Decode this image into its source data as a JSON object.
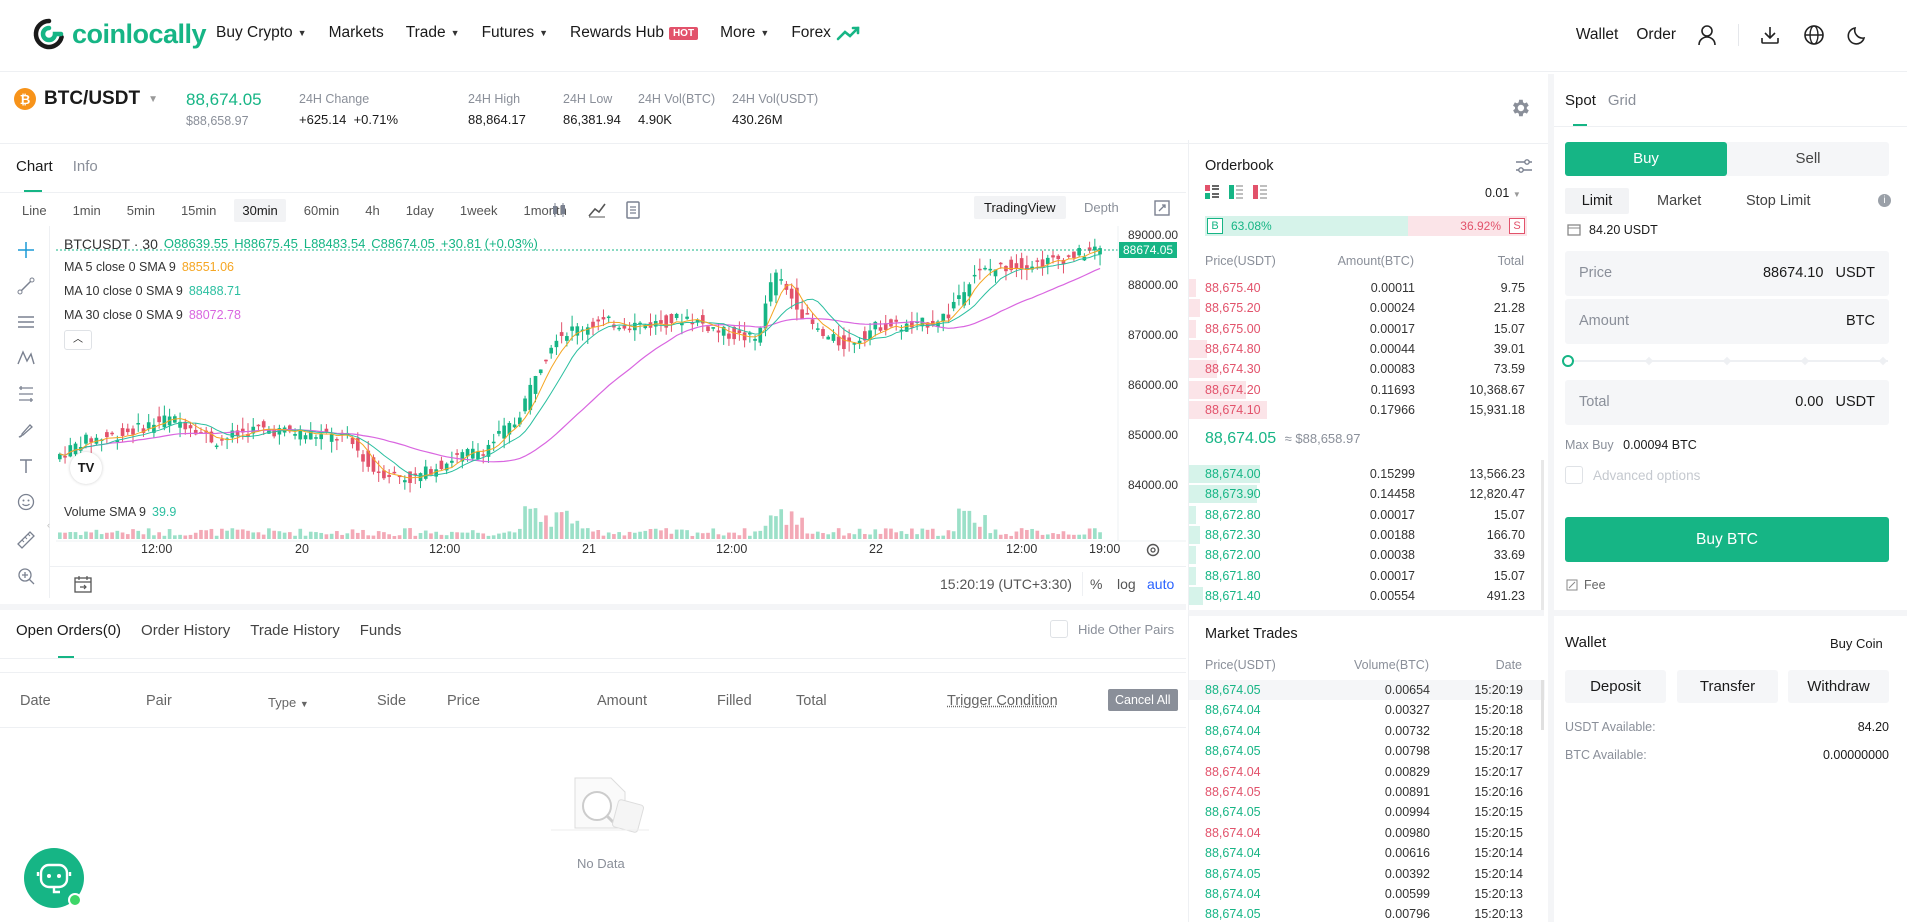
{
  "brand": {
    "name": "coinlocally"
  },
  "nav": {
    "items": [
      {
        "label": "Buy Crypto",
        "caret": true
      },
      {
        "label": "Markets",
        "caret": false
      },
      {
        "label": "Trade",
        "caret": true
      },
      {
        "label": "Futures",
        "caret": true
      },
      {
        "label": "Rewards Hub",
        "caret": false,
        "badge": "HOT"
      },
      {
        "label": "More",
        "caret": true
      },
      {
        "label": "Forex",
        "caret": false
      }
    ],
    "wallet": "Wallet",
    "order": "Order"
  },
  "ticker": {
    "pair": "BTC/USDT",
    "last_price": "88,674.05",
    "last_price_usd": "$88,658.97",
    "change_label": "24H Change",
    "change_abs": "+625.14",
    "change_pct": "+0.71%",
    "high_label": "24H High",
    "high": "88,864.17",
    "low_label": "24H Low",
    "low": "86,381.94",
    "vol_btc_label": "24H Vol(BTC)",
    "vol_btc": "4.90K",
    "vol_usdt_label": "24H Vol(USDT)",
    "vol_usdt": "430.26M"
  },
  "chart_panel": {
    "tabs": [
      "Chart",
      "Info"
    ],
    "timeframes": [
      "Line",
      "1min",
      "5min",
      "15min",
      "30min",
      "60min",
      "4h",
      "1day",
      "1week",
      "1month"
    ],
    "active_timeframe": "30min",
    "view_tradingview": "TradingView",
    "view_depth": "Depth",
    "symbol_line": "BTCUSDT · 30",
    "ohlc": {
      "o": "O88639.55",
      "h": "H88675.45",
      "l": "L88483.54",
      "c": "C88674.05",
      "chg": "+30.81 (+0.03%)"
    },
    "ma5_label": "MA 5 close 0 SMA 9",
    "ma5_value": "88551.06",
    "ma10_label": "MA 10 close 0 SMA 9",
    "ma10_value": "88488.71",
    "ma30_label": "MA 30 close 0 SMA 9",
    "ma30_value": "88072.78",
    "volume_label": "Volume SMA 9",
    "volume_value": "39.9",
    "price_ticks": [
      "89000.00",
      "88000.00",
      "87000.00",
      "86000.00",
      "85000.00",
      "84000.00"
    ],
    "last_tag": "88674.05",
    "time_ticks": [
      "12:00",
      "20",
      "12:00",
      "21",
      "12:00",
      "22",
      "12:00",
      "19:00"
    ],
    "clock": "15:20:19 (UTC+3:30)",
    "scale_pct": "%",
    "scale_log": "log",
    "scale_auto": "auto",
    "colors": {
      "up": "#16b585",
      "down": "#e2526b",
      "ma5": "#f5a623",
      "ma10": "#2bbfa0",
      "ma30": "#d966e0"
    }
  },
  "orders": {
    "tabs": [
      "Open Orders(0)",
      "Order History",
      "Trade History",
      "Funds"
    ],
    "hide_other_pairs": "Hide Other Pairs",
    "columns": [
      "Date",
      "Pair",
      "Type",
      "Side",
      "Price",
      "Amount",
      "Filled",
      "Total",
      "Trigger Condition"
    ],
    "cancel_all": "Cancel All",
    "empty": "No Data"
  },
  "orderbook": {
    "title": "Orderbook",
    "precision": "0.01",
    "buy_ratio_label": "B",
    "buy_ratio": "63.08%",
    "sell_ratio": "36.92%",
    "sell_ratio_label": "S",
    "buy_ratio_fraction": 0.6308,
    "columns": [
      "Price(USDT)",
      "Amount(BTC)",
      "Total"
    ],
    "asks": [
      {
        "price": "88,675.40",
        "amount": "0.00011",
        "total": "9.75",
        "depth": 0.02
      },
      {
        "price": "88,675.20",
        "amount": "0.00024",
        "total": "21.28",
        "depth": 0.03
      },
      {
        "price": "88,675.00",
        "amount": "0.00017",
        "total": "15.07",
        "depth": 0.02
      },
      {
        "price": "88,674.80",
        "amount": "0.00044",
        "total": "39.01",
        "depth": 0.05
      },
      {
        "price": "88,674.30",
        "amount": "0.00083",
        "total": "73.59",
        "depth": 0.08
      },
      {
        "price": "88,674.20",
        "amount": "0.11693",
        "total": "10,368.67",
        "depth": 0.16
      },
      {
        "price": "88,674.10",
        "amount": "0.17966",
        "total": "15,931.18",
        "depth": 0.22
      }
    ],
    "mid_price": "88,674.05",
    "mid_usd": "≈ $88,658.97",
    "bids": [
      {
        "price": "88,674.00",
        "amount": "0.15299",
        "total": "13,566.23",
        "depth": 0.2
      },
      {
        "price": "88,673.90",
        "amount": "0.14458",
        "total": "12,820.47",
        "depth": 0.19
      },
      {
        "price": "88,672.80",
        "amount": "0.00017",
        "total": "15.07",
        "depth": 0.02
      },
      {
        "price": "88,672.30",
        "amount": "0.00188",
        "total": "166.70",
        "depth": 0.03
      },
      {
        "price": "88,672.00",
        "amount": "0.00038",
        "total": "33.69",
        "depth": 0.02
      },
      {
        "price": "88,671.80",
        "amount": "0.00017",
        "total": "15.07",
        "depth": 0.02
      },
      {
        "price": "88,671.40",
        "amount": "0.00554",
        "total": "491.23",
        "depth": 0.04
      }
    ]
  },
  "market_trades": {
    "title": "Market Trades",
    "columns": [
      "Price(USDT)",
      "Volume(BTC)",
      "Date"
    ],
    "rows": [
      {
        "price": "88,674.05",
        "volume": "0.00654",
        "time": "15:20:19",
        "side": "buy"
      },
      {
        "price": "88,674.04",
        "volume": "0.00327",
        "time": "15:20:18",
        "side": "buy"
      },
      {
        "price": "88,674.04",
        "volume": "0.00732",
        "time": "15:20:18",
        "side": "buy"
      },
      {
        "price": "88,674.05",
        "volume": "0.00798",
        "time": "15:20:17",
        "side": "buy"
      },
      {
        "price": "88,674.04",
        "volume": "0.00829",
        "time": "15:20:17",
        "side": "sell"
      },
      {
        "price": "88,674.05",
        "volume": "0.00891",
        "time": "15:20:16",
        "side": "sell"
      },
      {
        "price": "88,674.05",
        "volume": "0.00994",
        "time": "15:20:15",
        "side": "buy"
      },
      {
        "price": "88,674.04",
        "volume": "0.00980",
        "time": "15:20:15",
        "side": "sell"
      },
      {
        "price": "88,674.04",
        "volume": "0.00616",
        "time": "15:20:14",
        "side": "buy"
      },
      {
        "price": "88,674.05",
        "volume": "0.00392",
        "time": "15:20:14",
        "side": "buy"
      },
      {
        "price": "88,674.04",
        "volume": "0.00599",
        "time": "15:20:13",
        "side": "buy"
      },
      {
        "price": "88,674.05",
        "volume": "0.00796",
        "time": "15:20:13",
        "side": "buy"
      }
    ]
  },
  "trade_form": {
    "tabs": [
      "Spot",
      "Grid"
    ],
    "buy": "Buy",
    "sell": "Sell",
    "order_types": [
      "Limit",
      "Market",
      "Stop Limit"
    ],
    "available": "84.20 USDT",
    "price_label": "Price",
    "price_value": "88674.10",
    "price_unit": "USDT",
    "amount_label": "Amount",
    "amount_unit": "BTC",
    "total_label": "Total",
    "total_value": "0.00",
    "total_unit": "USDT",
    "max_buy_label": "Max Buy",
    "max_buy_value": "0.00094 BTC",
    "advanced": "Advanced options",
    "buy_button": "Buy BTC",
    "fee": "Fee"
  },
  "wallet": {
    "title": "Wallet",
    "buy_coin": "Buy Coin",
    "deposit": "Deposit",
    "transfer": "Transfer",
    "withdraw": "Withdraw",
    "usdt_label": "USDT Available:",
    "usdt_value": "84.20",
    "btc_label": "BTC Available:",
    "btc_value": "0.00000000"
  }
}
